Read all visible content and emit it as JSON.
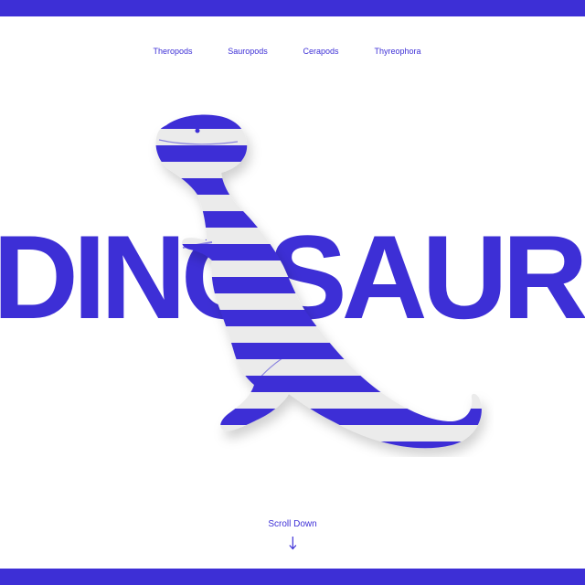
{
  "colors": {
    "brand": "#3d2fd6",
    "background": "#ffffff",
    "dino_light": "#ebebeb"
  },
  "nav": {
    "items": [
      {
        "label": "Theropods"
      },
      {
        "label": "Sauropods"
      },
      {
        "label": "Cerapods"
      },
      {
        "label": "Thyreophora"
      }
    ]
  },
  "hero": {
    "title": "DINOSAURS",
    "image_icon": "striped-dinosaur-figurine"
  },
  "scroll": {
    "label": "Scroll Down",
    "icon": "arrow-down-icon"
  }
}
